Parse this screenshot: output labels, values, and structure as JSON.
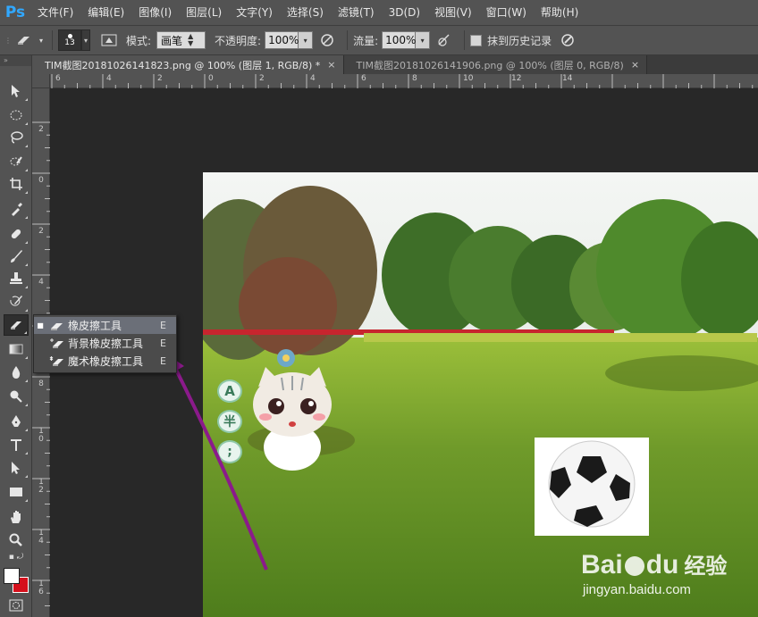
{
  "app": {
    "logo": "Ps"
  },
  "menu": [
    "文件(F)",
    "编辑(E)",
    "图像(I)",
    "图层(L)",
    "文字(Y)",
    "选择(S)",
    "滤镜(T)",
    "3D(D)",
    "视图(V)",
    "窗口(W)",
    "帮助(H)"
  ],
  "options": {
    "brush_size": "13",
    "mode_label": "模式:",
    "mode_value": "画笔",
    "opacity_label": "不透明度:",
    "opacity_value": "100%",
    "flow_label": "流量:",
    "flow_value": "100%",
    "erase_history_label": "抹到历史记录"
  },
  "tabs": [
    {
      "label": "TIM截图20181026141823.png @ 100% (图层 1, RGB/8) *",
      "close": "×",
      "active": true
    },
    {
      "label": "TIM截图20181026141906.png @ 100% (图层 0, RGB/8)",
      "close": "×",
      "active": false
    }
  ],
  "ruler_top": [
    "6",
    "4",
    "2",
    "0",
    "2",
    "4",
    "6",
    "8",
    "10",
    "12",
    "14"
  ],
  "ruler_left": [
    "2",
    "0",
    "2",
    "4",
    "6",
    "8",
    "1 0",
    "1 2",
    "1 4",
    "1 6"
  ],
  "flyout": [
    {
      "label": "橡皮擦工具",
      "key": "E",
      "icon": "eraser-icon",
      "selected": true,
      "bullet": "■"
    },
    {
      "label": "背景橡皮擦工具",
      "key": "E",
      "icon": "background-eraser-icon",
      "selected": false,
      "bullet": ""
    },
    {
      "label": "魔术橡皮擦工具",
      "key": "E",
      "icon": "magic-eraser-icon",
      "selected": false,
      "bullet": ""
    }
  ],
  "sticker_badges": [
    "A",
    "半",
    ";"
  ],
  "watermark": {
    "brand_a": "Bai",
    "brand_b": "du",
    "brand_cn": "经验",
    "url": "jingyan.baidu.com"
  },
  "colors": {
    "ui_bg": "#535353",
    "canvas_bg": "#282828",
    "accent": "#31a8ff",
    "arrow": "#8b1a8b",
    "bg_swatch": "#d5101c"
  }
}
